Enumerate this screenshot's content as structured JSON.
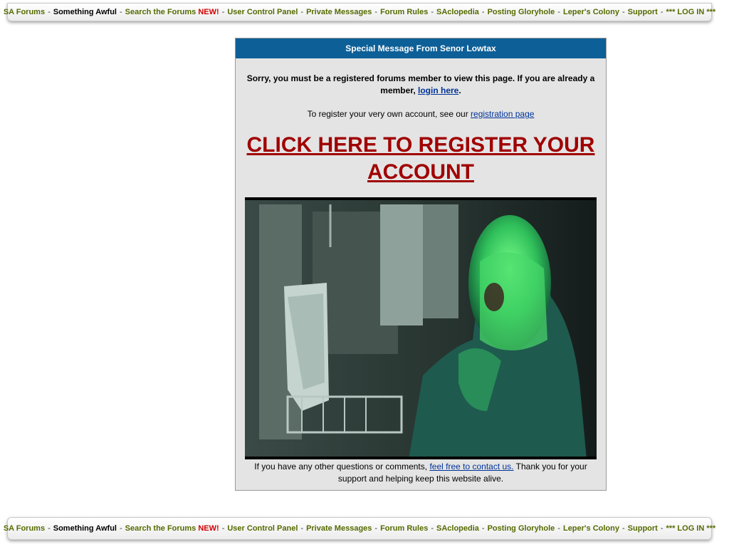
{
  "nav": {
    "sa_forums": "SA Forums",
    "something_awful": "Something Awful",
    "search": "Search the Forums",
    "new_badge": "NEW!",
    "ucp": "User Control Panel",
    "pm": "Private Messages",
    "rules": "Forum Rules",
    "saclopedia": "SAclopedia",
    "gloryhole": "Posting Gloryhole",
    "lepers": "Leper's Colony",
    "support": "Support",
    "login": "*** LOG IN ***",
    "separator": "-"
  },
  "panel": {
    "header": "Special Message From Senor Lowtax",
    "sorry_text": "Sorry, you must be a registered forums member to view this page. If you are already a member,",
    "login_link": "login here",
    "period": ".",
    "register_text": "To register your very own account, see our",
    "registration_link": "registration page",
    "big_link": "CLICK HERE TO REGISTER YOUR ACCOUNT",
    "footer_text_1": "If you have any other questions or comments,",
    "contact_link": "feel free to contact us.",
    "footer_text_2": "Thank you for your support and helping keep this website alive."
  },
  "colors": {
    "header_bg": "#0d5f97",
    "nav_link": "#556b00",
    "new_badge": "#d60000",
    "big_link": "#a00000"
  }
}
